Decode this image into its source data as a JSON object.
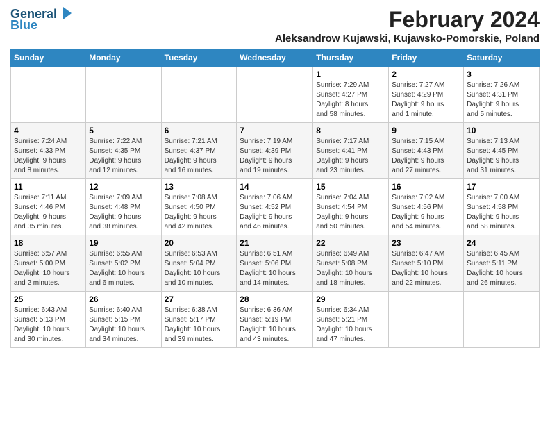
{
  "logo": {
    "text1": "General",
    "text2": "Blue"
  },
  "title": "February 2024",
  "subtitle": "Aleksandrow Kujawski, Kujawsko-Pomorskie, Poland",
  "columns": [
    "Sunday",
    "Monday",
    "Tuesday",
    "Wednesday",
    "Thursday",
    "Friday",
    "Saturday"
  ],
  "weeks": [
    [
      {
        "day": "",
        "info": ""
      },
      {
        "day": "",
        "info": ""
      },
      {
        "day": "",
        "info": ""
      },
      {
        "day": "",
        "info": ""
      },
      {
        "day": "1",
        "info": "Sunrise: 7:29 AM\nSunset: 4:27 PM\nDaylight: 8 hours\nand 58 minutes."
      },
      {
        "day": "2",
        "info": "Sunrise: 7:27 AM\nSunset: 4:29 PM\nDaylight: 9 hours\nand 1 minute."
      },
      {
        "day": "3",
        "info": "Sunrise: 7:26 AM\nSunset: 4:31 PM\nDaylight: 9 hours\nand 5 minutes."
      }
    ],
    [
      {
        "day": "4",
        "info": "Sunrise: 7:24 AM\nSunset: 4:33 PM\nDaylight: 9 hours\nand 8 minutes."
      },
      {
        "day": "5",
        "info": "Sunrise: 7:22 AM\nSunset: 4:35 PM\nDaylight: 9 hours\nand 12 minutes."
      },
      {
        "day": "6",
        "info": "Sunrise: 7:21 AM\nSunset: 4:37 PM\nDaylight: 9 hours\nand 16 minutes."
      },
      {
        "day": "7",
        "info": "Sunrise: 7:19 AM\nSunset: 4:39 PM\nDaylight: 9 hours\nand 19 minutes."
      },
      {
        "day": "8",
        "info": "Sunrise: 7:17 AM\nSunset: 4:41 PM\nDaylight: 9 hours\nand 23 minutes."
      },
      {
        "day": "9",
        "info": "Sunrise: 7:15 AM\nSunset: 4:43 PM\nDaylight: 9 hours\nand 27 minutes."
      },
      {
        "day": "10",
        "info": "Sunrise: 7:13 AM\nSunset: 4:45 PM\nDaylight: 9 hours\nand 31 minutes."
      }
    ],
    [
      {
        "day": "11",
        "info": "Sunrise: 7:11 AM\nSunset: 4:46 PM\nDaylight: 9 hours\nand 35 minutes."
      },
      {
        "day": "12",
        "info": "Sunrise: 7:09 AM\nSunset: 4:48 PM\nDaylight: 9 hours\nand 38 minutes."
      },
      {
        "day": "13",
        "info": "Sunrise: 7:08 AM\nSunset: 4:50 PM\nDaylight: 9 hours\nand 42 minutes."
      },
      {
        "day": "14",
        "info": "Sunrise: 7:06 AM\nSunset: 4:52 PM\nDaylight: 9 hours\nand 46 minutes."
      },
      {
        "day": "15",
        "info": "Sunrise: 7:04 AM\nSunset: 4:54 PM\nDaylight: 9 hours\nand 50 minutes."
      },
      {
        "day": "16",
        "info": "Sunrise: 7:02 AM\nSunset: 4:56 PM\nDaylight: 9 hours\nand 54 minutes."
      },
      {
        "day": "17",
        "info": "Sunrise: 7:00 AM\nSunset: 4:58 PM\nDaylight: 9 hours\nand 58 minutes."
      }
    ],
    [
      {
        "day": "18",
        "info": "Sunrise: 6:57 AM\nSunset: 5:00 PM\nDaylight: 10 hours\nand 2 minutes."
      },
      {
        "day": "19",
        "info": "Sunrise: 6:55 AM\nSunset: 5:02 PM\nDaylight: 10 hours\nand 6 minutes."
      },
      {
        "day": "20",
        "info": "Sunrise: 6:53 AM\nSunset: 5:04 PM\nDaylight: 10 hours\nand 10 minutes."
      },
      {
        "day": "21",
        "info": "Sunrise: 6:51 AM\nSunset: 5:06 PM\nDaylight: 10 hours\nand 14 minutes."
      },
      {
        "day": "22",
        "info": "Sunrise: 6:49 AM\nSunset: 5:08 PM\nDaylight: 10 hours\nand 18 minutes."
      },
      {
        "day": "23",
        "info": "Sunrise: 6:47 AM\nSunset: 5:10 PM\nDaylight: 10 hours\nand 22 minutes."
      },
      {
        "day": "24",
        "info": "Sunrise: 6:45 AM\nSunset: 5:11 PM\nDaylight: 10 hours\nand 26 minutes."
      }
    ],
    [
      {
        "day": "25",
        "info": "Sunrise: 6:43 AM\nSunset: 5:13 PM\nDaylight: 10 hours\nand 30 minutes."
      },
      {
        "day": "26",
        "info": "Sunrise: 6:40 AM\nSunset: 5:15 PM\nDaylight: 10 hours\nand 34 minutes."
      },
      {
        "day": "27",
        "info": "Sunrise: 6:38 AM\nSunset: 5:17 PM\nDaylight: 10 hours\nand 39 minutes."
      },
      {
        "day": "28",
        "info": "Sunrise: 6:36 AM\nSunset: 5:19 PM\nDaylight: 10 hours\nand 43 minutes."
      },
      {
        "day": "29",
        "info": "Sunrise: 6:34 AM\nSunset: 5:21 PM\nDaylight: 10 hours\nand 47 minutes."
      },
      {
        "day": "",
        "info": ""
      },
      {
        "day": "",
        "info": ""
      }
    ]
  ]
}
